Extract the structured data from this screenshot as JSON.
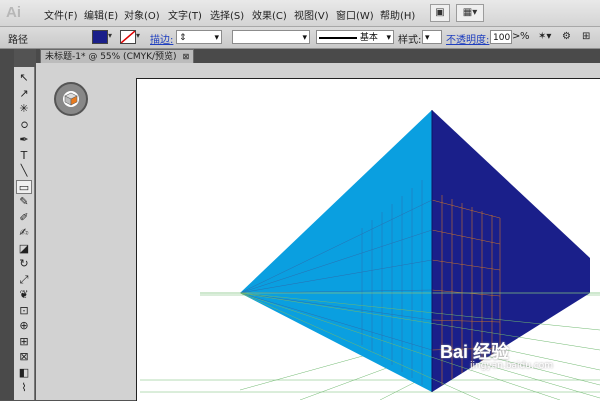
{
  "app": {
    "logo": "Ai"
  },
  "menubar": {
    "items": [
      {
        "label": "文件(F)"
      },
      {
        "label": "编辑(E)"
      },
      {
        "label": "对象(O)"
      },
      {
        "label": "文字(T)"
      },
      {
        "label": "选择(S)"
      },
      {
        "label": "效果(C)"
      },
      {
        "label": "视图(V)"
      },
      {
        "label": "窗口(W)"
      },
      {
        "label": "帮助(H)"
      }
    ],
    "bridge_icon": "bridge-icon",
    "arrange_icon": "arrange-documents-icon"
  },
  "control_bar": {
    "object_type": "路径",
    "fill_color": "#1a1f8a",
    "stroke_color": "none",
    "stroke_label": "描边:",
    "stroke_profile_label": "基本",
    "style_label": "样式:",
    "opacity_label": "不透明度:",
    "opacity_value": "100",
    "percent": "%"
  },
  "document": {
    "tab_title": "未标题-1* @ 55% (CMYK/预览)",
    "close_glyph": "⊠"
  },
  "tools": [
    {
      "name": "selection-tool-icon",
      "glyph": "↖",
      "selected": false
    },
    {
      "name": "direct-selection-tool-icon",
      "glyph": "↗",
      "selected": false
    },
    {
      "name": "magic-wand-tool-icon",
      "glyph": "✳",
      "selected": false
    },
    {
      "name": "lasso-tool-icon",
      "glyph": "ഠ",
      "selected": false
    },
    {
      "name": "pen-tool-icon",
      "glyph": "✒",
      "selected": false
    },
    {
      "name": "type-tool-icon",
      "glyph": "T",
      "selected": false
    },
    {
      "name": "line-tool-icon",
      "glyph": "╲",
      "selected": false
    },
    {
      "name": "rectangle-tool-icon",
      "glyph": "▭",
      "selected": true
    },
    {
      "name": "paintbrush-tool-icon",
      "glyph": "✎",
      "selected": false
    },
    {
      "name": "pencil-tool-icon",
      "glyph": "✐",
      "selected": false
    },
    {
      "name": "blob-brush-tool-icon",
      "glyph": "✍",
      "selected": false
    },
    {
      "name": "eraser-tool-icon",
      "glyph": "◪",
      "selected": false
    },
    {
      "name": "rotate-tool-icon",
      "glyph": "↻",
      "selected": false
    },
    {
      "name": "scale-tool-icon",
      "glyph": "⤢",
      "selected": false
    },
    {
      "name": "warp-tool-icon",
      "glyph": "❦",
      "selected": false
    },
    {
      "name": "free-transform-tool-icon",
      "glyph": "⊡",
      "selected": false
    },
    {
      "name": "shape-builder-tool-icon",
      "glyph": "⊕",
      "selected": false
    },
    {
      "name": "perspective-grid-tool-icon",
      "glyph": "⊞",
      "selected": false
    },
    {
      "name": "mesh-tool-icon",
      "glyph": "⊠",
      "selected": false
    },
    {
      "name": "gradient-tool-icon",
      "glyph": "◧",
      "selected": false
    },
    {
      "name": "eyedropper-tool-icon",
      "glyph": "⌇",
      "selected": false
    }
  ],
  "colors": {
    "left_plane": "#0a9fe0",
    "right_plane": "#1a1f8a",
    "grid_left": "#2a8cc8",
    "grid_right": "#c8702a",
    "grid_floor": "#6fb86f",
    "widget_orange": "#e87a1e"
  },
  "watermark": {
    "text": "Bai 经验",
    "sub": "jingyan.baidu.com"
  }
}
